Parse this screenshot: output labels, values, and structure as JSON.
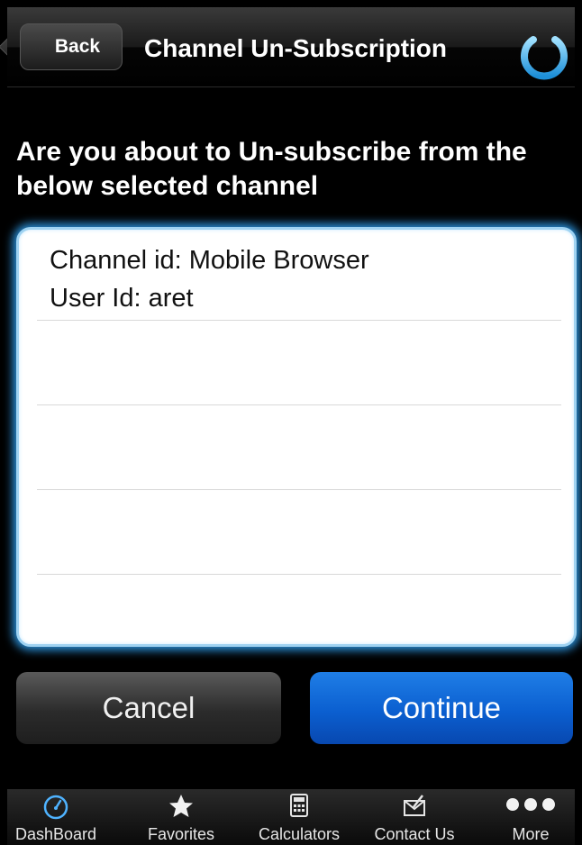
{
  "header": {
    "back_label": "Back",
    "title": "Channel Un-Subscription",
    "power_icon": "power-icon"
  },
  "prompt": "Are you about to Un-subscribe from the below selected channel",
  "details": {
    "channel_line": "Channel id: Mobile Browser",
    "user_line": "User Id: aret"
  },
  "actions": {
    "cancel_label": "Cancel",
    "continue_label": "Continue"
  },
  "tabbar": {
    "tabs": [
      {
        "label": "DashBoard",
        "icon": "gauge-icon"
      },
      {
        "label": "Favorites",
        "icon": "star-icon"
      },
      {
        "label": "Calculators",
        "icon": "calculator-icon"
      },
      {
        "label": "Contact Us",
        "icon": "envelope-icon"
      },
      {
        "label": "More",
        "icon": "more-icon"
      }
    ]
  },
  "colors": {
    "accent_blue": "#0b5fd0",
    "glow_blue": "#2a8fd6",
    "power_blue": "#48b4f0"
  }
}
